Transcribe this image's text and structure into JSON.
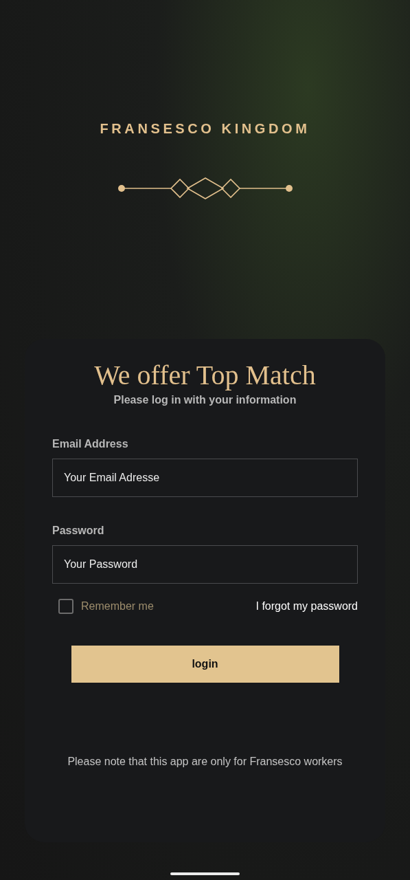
{
  "brand": {
    "title": "FRANSESCO KINGDOM"
  },
  "card": {
    "heading": "We offer Top Match",
    "subtitle": "Please log in with your information"
  },
  "fields": [
    {
      "label": "Email Address",
      "placeholder": "Your Email Adresse"
    },
    {
      "label": "Password",
      "placeholder": "Your Password"
    }
  ],
  "remember": {
    "label": "Remember me",
    "checked": false
  },
  "forgot_link": "I forgot my password",
  "login_button": "login",
  "note": "Please note that this app are only for Fransesco workers"
}
